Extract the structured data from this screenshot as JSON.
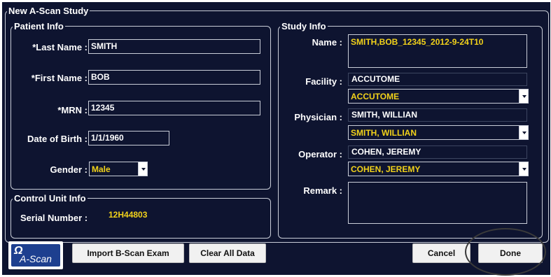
{
  "window": {
    "title": "New A-Scan Study"
  },
  "patient_info": {
    "legend": "Patient Info",
    "last_name": {
      "label": "*Last Name :",
      "value": "SMITH"
    },
    "first_name": {
      "label": "*First Name :",
      "value": "BOB"
    },
    "mrn": {
      "label": "*MRN :",
      "value": "12345"
    },
    "dob": {
      "label": "Date of Birth :",
      "value": "1/1/1960"
    },
    "gender": {
      "label": "Gender :",
      "value": "Male"
    }
  },
  "control_unit": {
    "legend": "Control Unit Info",
    "serial_label": "Serial Number :",
    "serial_value": "12H44803"
  },
  "study_info": {
    "legend": "Study Info",
    "name": {
      "label": "Name :",
      "value": "SMITH,BOB_12345_2012-9-24T10"
    },
    "facility": {
      "label": "Facility :",
      "current": "ACCUTOME",
      "selected": "ACCUTOME"
    },
    "physician": {
      "label": "Physician :",
      "current": "SMITH, WILLIAN",
      "selected": "SMITH, WILLIAN"
    },
    "operator": {
      "label": "Operator :",
      "current": "COHEN, JEREMY",
      "selected": "COHEN, JEREMY"
    },
    "remark": {
      "label": "Remark :",
      "value": ""
    }
  },
  "buttons": {
    "logo_glyph": "Ω",
    "logo_text": "A-Scan",
    "import": "Import B-Scan Exam",
    "clear": "Clear All Data",
    "cancel": "Cancel",
    "done": "Done"
  },
  "colors": {
    "background": "#0e1430",
    "highlight": "#f2d21a",
    "border": "#c9cdd8"
  }
}
